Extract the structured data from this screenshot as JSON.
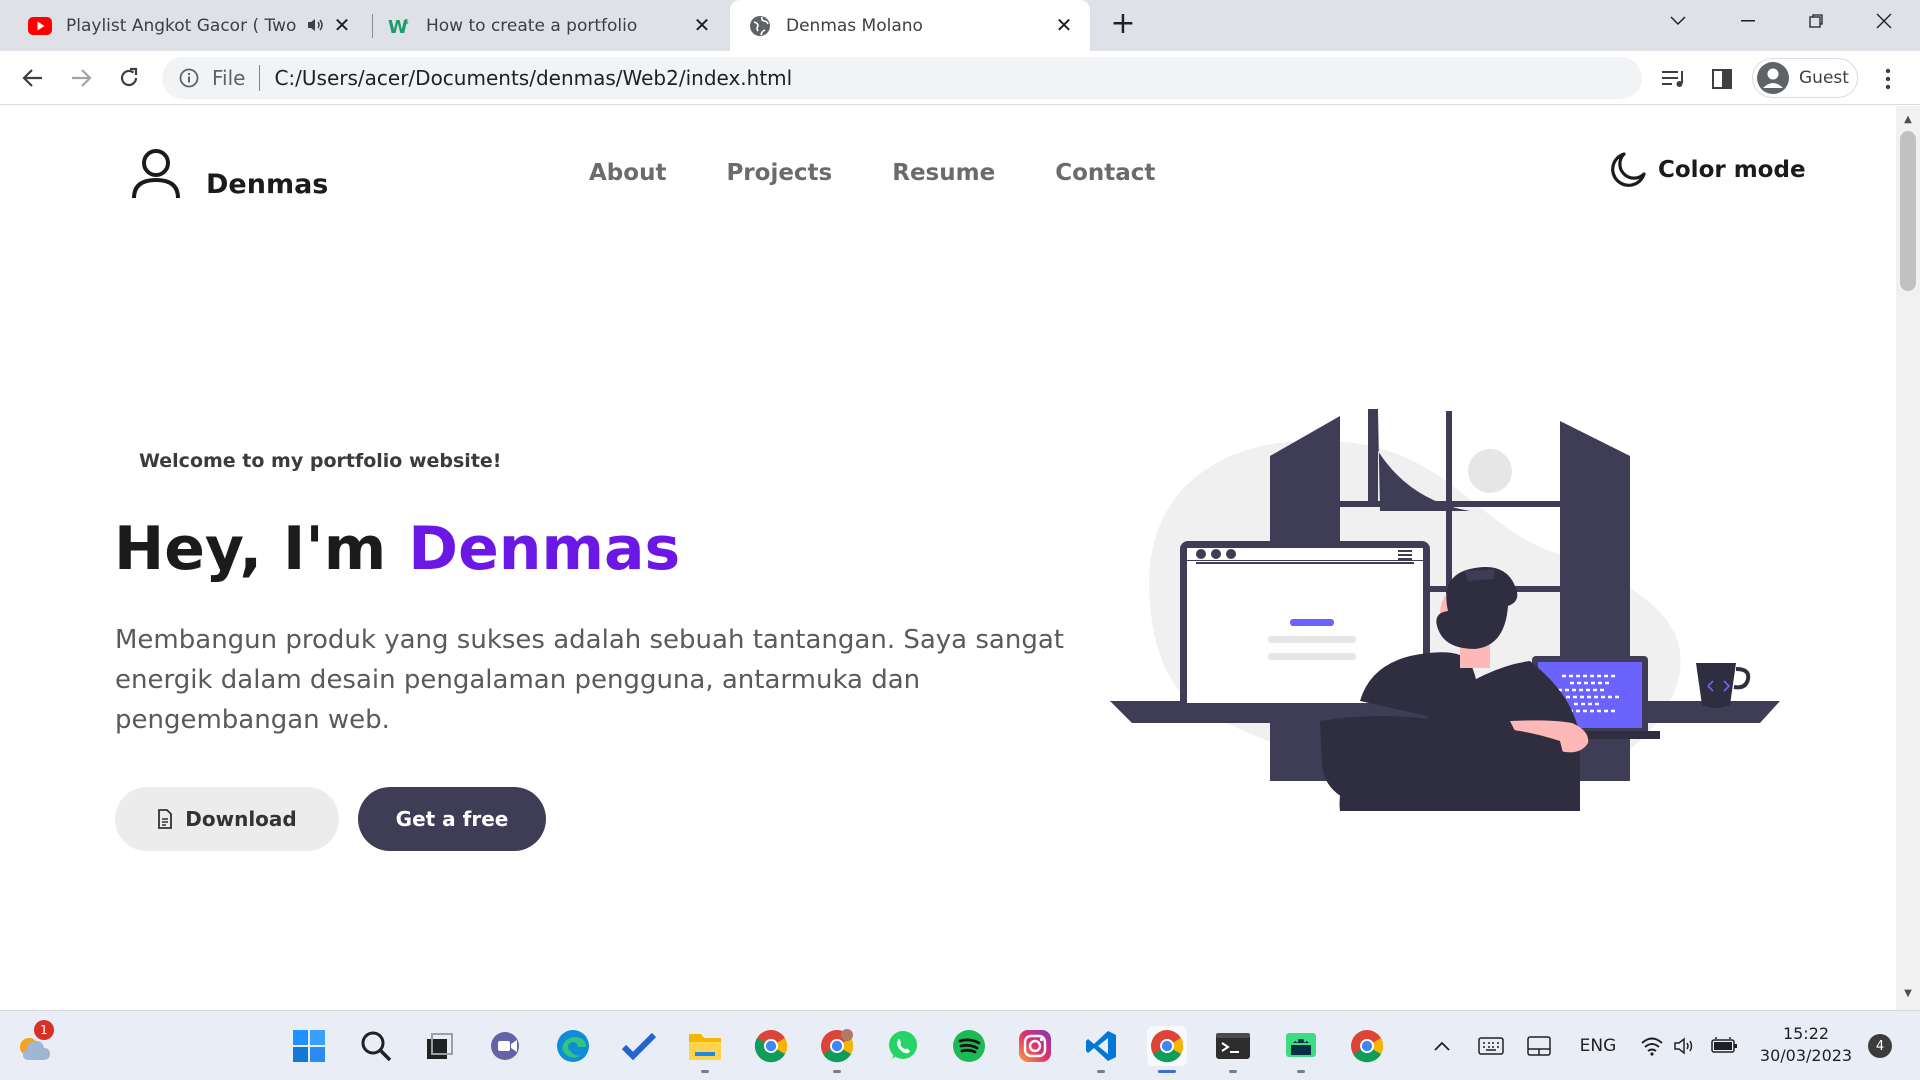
{
  "browser": {
    "tabs": [
      {
        "title": "Playlist Angkot Gacor ( Two V",
        "favicon": "youtube-icon",
        "audio": true
      },
      {
        "title": "How to create a portfolio",
        "favicon": "w-logo-icon"
      },
      {
        "title": "Denmas Molano",
        "favicon": "globe-icon",
        "active": true
      }
    ],
    "address": {
      "scheme": "File",
      "url": "C:/Users/acer/Documents/denmas/Web2/index.html"
    },
    "profile_label": "Guest"
  },
  "site": {
    "brand": "Denmas",
    "nav": [
      "About",
      "Projects",
      "Resume",
      "Contact"
    ],
    "color_mode_label": "Color mode",
    "welcome": "Welcome to my portfolio website!",
    "hero_prefix": "Hey, I'm",
    "hero_name": "Denmas",
    "description": "Membangun produk yang sukses adalah sebuah tantangan. Saya sangat energik dalam desain pengalaman pengguna, antarmuka dan pengembangan web.",
    "buttons": {
      "download": "Download",
      "free": "Get a free"
    },
    "colors": {
      "accent": "#6b17e6",
      "dark": "#3f3d56",
      "illustration_purple": "#6c63ff"
    }
  },
  "taskbar": {
    "weather_badge": "1",
    "apps": [
      "windows-start-icon",
      "search-icon",
      "task-view-icon",
      "meet-icon",
      "edge-icon",
      "todo-icon",
      "file-explorer-icon",
      "chrome-icon",
      "chrome-profile-icon",
      "whatsapp-icon",
      "spotify-icon",
      "instagram-icon",
      "vscode-icon",
      "chrome-active-icon",
      "terminal-icon",
      "android-studio-icon",
      "chrome-icon-2"
    ],
    "language": "ENG",
    "time": "15:22",
    "date": "30/03/2023",
    "notifications": "4"
  }
}
